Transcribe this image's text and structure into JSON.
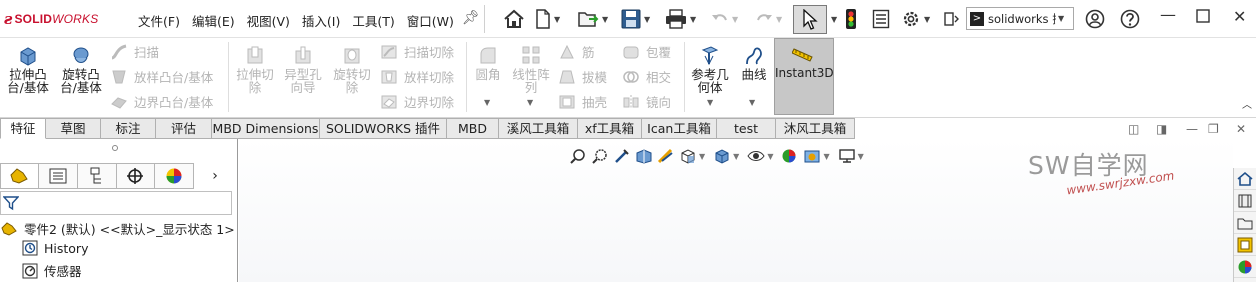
{
  "app": {
    "brand_prefix": "SOLID",
    "brand_suffix": "WORKS",
    "colors": {
      "brand": "#c8102e",
      "accent_blue": "#1f5fa8",
      "selected_tool": "#c7c7c7"
    }
  },
  "menu": [
    "文件(F)",
    "编辑(E)",
    "视图(V)",
    "插入(I)",
    "工具(T)",
    "窗口(W)"
  ],
  "toolbar_icons": [
    "home-icon",
    "new-document-icon",
    "open-icon",
    "save-icon",
    "print-icon",
    "undo-icon",
    "redo-icon",
    "select-pointer-icon",
    "traffic-light-icon",
    "file-properties-icon",
    "options-gear-icon"
  ],
  "search": {
    "placeholder": "solidworks 搜索命令"
  },
  "ribbon": {
    "extrude_boss": "拉伸凸\n台/基体",
    "revolve_boss": "旋转凸\n台/基体",
    "sweep": "扫描",
    "loft": "放样凸台/基体",
    "boundary": "边界凸台/基体",
    "extrude_cut": "拉伸切\n除",
    "hole_wizard": "异型孔\n向导",
    "revolve_cut": "旋转切\n除",
    "swept_cut": "扫描切除",
    "lofted_cut": "放样切除",
    "boundary_cut": "边界切除",
    "fillet": "圆角",
    "linear_pattern": "线性阵\n列",
    "rib": "筋",
    "draft": "拔模",
    "shell": "抽壳",
    "wrap": "包覆",
    "intersect": "相交",
    "mirror": "镜向",
    "ref_geometry": "参考几\n何体",
    "curves": "曲线",
    "instant3d": "Instant3D"
  },
  "tabs": [
    "特征",
    "草图",
    "标注",
    "评估",
    "MBD Dimensions",
    "SOLIDWORKS 插件",
    "MBD",
    "溪风工具箱",
    "xf工具箱",
    "Ican工具箱",
    "test",
    "沐风工具箱"
  ],
  "active_tab": "特征",
  "feature_tree": {
    "part": "零件2 (默认) <<默认>_显示状态 1>",
    "items": [
      "History",
      "传感器"
    ]
  },
  "watermark": {
    "main": "SW自学网",
    "sub": "www.swrjzxw.com"
  }
}
